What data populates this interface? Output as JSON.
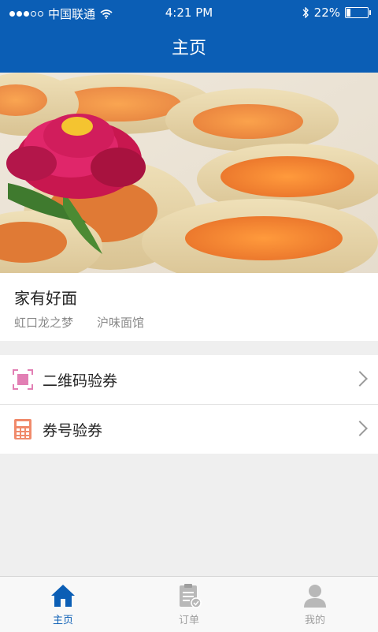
{
  "status_bar": {
    "carrier": "中国联通",
    "time": "4:21 PM",
    "battery_percent": "22%",
    "battery_level": 0.22,
    "signal_bars": 3
  },
  "nav": {
    "title": "主页"
  },
  "restaurant": {
    "name": "家有好面",
    "tags": [
      "虹口龙之梦",
      "沪味面馆"
    ]
  },
  "menu": {
    "items": [
      {
        "label": "二维码验券",
        "icon": "qr-scan-icon"
      },
      {
        "label": "券号验券",
        "icon": "calculator-icon"
      }
    ]
  },
  "tabbar": {
    "tabs": [
      {
        "label": "主页",
        "icon": "home-icon",
        "active": true
      },
      {
        "label": "订单",
        "icon": "order-icon",
        "active": false
      },
      {
        "label": "我的",
        "icon": "user-icon",
        "active": false
      }
    ]
  },
  "colors": {
    "primary": "#0b5eb5",
    "qr_icon": "#e27fb4",
    "calc_icon": "#f08a6b"
  }
}
